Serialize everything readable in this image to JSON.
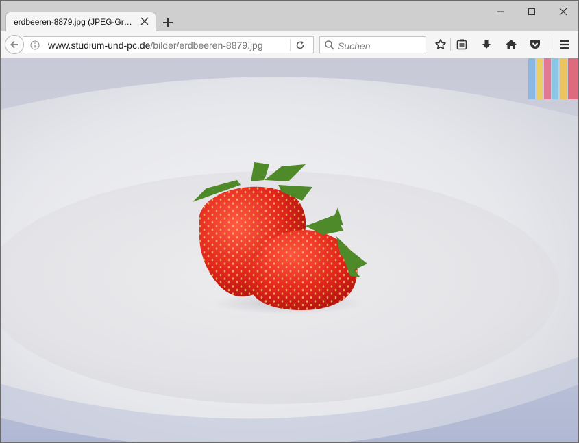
{
  "window": {
    "tab_title": "erdbeeren-8879.jpg (JPEG-Graf...",
    "controls": [
      "minimize-icon",
      "maximize-icon",
      "close-icon"
    ]
  },
  "toolbar": {
    "url_domain": "www.studium-und-pc.de",
    "url_path": "/bilder/erdbeeren-8879.jpg",
    "search_placeholder": "Suchen",
    "icons": [
      "back-arrow-icon",
      "info-icon",
      "reload-icon",
      "search-icon",
      "bookmark-star-icon",
      "reading-list-icon",
      "download-icon",
      "home-icon",
      "pocket-icon",
      "hamburger-menu-icon"
    ]
  },
  "content": {
    "image": "two strawberries in a white bowl",
    "colors": {
      "berry": "#e0241c",
      "leaf": "#4f8a2a",
      "bowl": "#eeeff2"
    }
  }
}
